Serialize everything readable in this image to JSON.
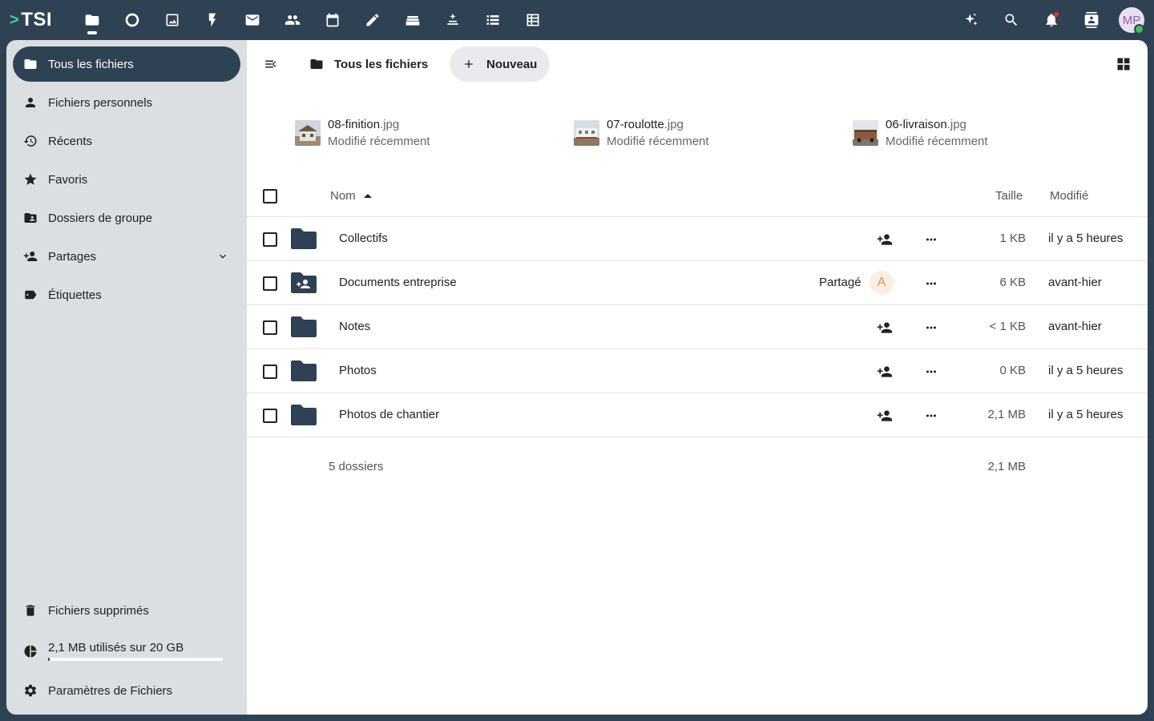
{
  "topbar": {
    "logo_text": "TSI",
    "logo_chevron": ">",
    "apps": [
      {
        "name": "files-icon",
        "active": true
      },
      {
        "name": "activity-icon",
        "active": false
      },
      {
        "name": "photos-icon",
        "active": false
      },
      {
        "name": "flash-icon",
        "active": false
      },
      {
        "name": "mail-icon",
        "active": false
      },
      {
        "name": "contacts-icon",
        "active": false
      },
      {
        "name": "calendar-icon",
        "active": false
      },
      {
        "name": "notes-icon",
        "active": false
      },
      {
        "name": "deck-icon",
        "active": false
      },
      {
        "name": "assistant-icon",
        "active": false
      },
      {
        "name": "tasks-icon",
        "active": false
      },
      {
        "name": "tables-icon",
        "active": false
      }
    ],
    "user_initials": "MP",
    "status_color": "#46ba61",
    "notification_color": "#e9322d"
  },
  "sidebar": {
    "items": [
      {
        "label": "Tous les fichiers",
        "icon": "folder-icon",
        "active": true
      },
      {
        "label": "Fichiers personnels",
        "icon": "person-icon",
        "active": false
      },
      {
        "label": "Récents",
        "icon": "history-icon",
        "active": false
      },
      {
        "label": "Favoris",
        "icon": "star-icon",
        "active": false
      },
      {
        "label": "Dossiers de groupe",
        "icon": "group-folder-icon",
        "active": false
      },
      {
        "label": "Partages",
        "icon": "share-icon",
        "active": false,
        "expandable": true
      },
      {
        "label": "Étiquettes",
        "icon": "tag-icon",
        "active": false
      }
    ],
    "trash_label": "Fichiers supprimés",
    "quota_label": "2,1 MB utilisés sur 20 GB",
    "quota_fraction": 0.0001,
    "settings_label": "Paramètres de Fichiers"
  },
  "main": {
    "breadcrumb": "Tous les fichiers",
    "new_label": "Nouveau",
    "recent_files": [
      {
        "base": "08-finition",
        "ext": ".jpg",
        "subtitle": "Modifié récemment"
      },
      {
        "base": "07-roulotte",
        "ext": ".jpg",
        "subtitle": "Modifié récemment"
      },
      {
        "base": "06-livraison",
        "ext": ".jpg",
        "subtitle": "Modifié récemment"
      }
    ],
    "columns": {
      "name": "Nom",
      "size": "Taille",
      "modified": "Modifié"
    },
    "rows": [
      {
        "name": "Collectifs",
        "size": "1 KB",
        "modified": "il y a 5 heures",
        "shared": false
      },
      {
        "name": "Documents entreprise",
        "size": "6 KB",
        "modified": "avant-hier",
        "shared": true,
        "shared_label": "Partagé",
        "shared_initial": "A"
      },
      {
        "name": "Notes",
        "size": "< 1 KB",
        "modified": "avant-hier",
        "shared": false
      },
      {
        "name": "Photos",
        "size": "0 KB",
        "modified": "il y a 5 heures",
        "shared": false
      },
      {
        "name": "Photos de chantier",
        "size": "2,1 MB",
        "modified": "il y a 5 heures",
        "shared": false
      }
    ],
    "summary_count": "5 dossiers",
    "summary_size": "2,1 MB",
    "accent_color": "#2f4253"
  }
}
